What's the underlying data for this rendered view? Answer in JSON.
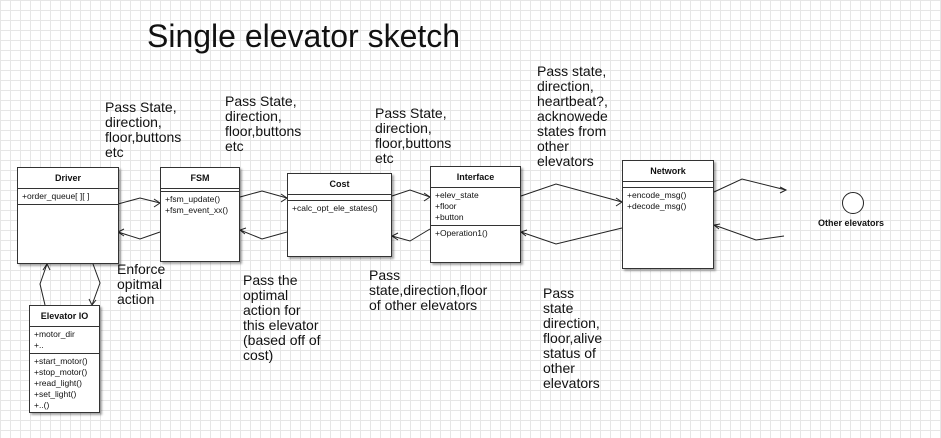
{
  "title": "Single elevator sketch",
  "classes": {
    "driver": {
      "name": "Driver",
      "attributes": [
        "+order_queue[ ][ ]"
      ],
      "operations": []
    },
    "fsm": {
      "name": "FSM",
      "attributes": [],
      "operations": [
        "+fsm_update()",
        "+fsm_event_xx()"
      ]
    },
    "cost": {
      "name": "Cost",
      "attributes": [],
      "operations": [
        "+calc_opt_ele_states()"
      ]
    },
    "interface": {
      "name": "Interface",
      "attributes": [
        "+elev_state",
        "+floor",
        "+button"
      ],
      "operations": [
        "+Operation1()"
      ]
    },
    "network": {
      "name": "Network",
      "attributes": [],
      "operations": [
        "+encode_msg()",
        "+decode_msg()"
      ]
    },
    "elevator_io": {
      "name": "Elevator IO",
      "attributes": [
        "+motor_dir",
        "+.."
      ],
      "operations": [
        "+start_motor()",
        "+stop_motor()",
        "+read_light()",
        "+set_light()",
        "+..()"
      ]
    }
  },
  "actor": {
    "label": "Other elevators"
  },
  "notes": {
    "driver_to_fsm": "Pass State,\ndirection,\nfloor,buttons\netc",
    "fsm_to_cost": "Pass State,\ndirection,\nfloor,buttons\netc",
    "cost_to_interface": "Pass State,\ndirection,\nfloor,buttons\netc",
    "interface_to_network": "Pass state,\ndirection,\nheartbeat?,\nacknowede\nstates from\nother\nelevators",
    "fsm_to_driver": "Enforce\nopitmal\naction",
    "cost_to_fsm": "Pass the\noptimal\naction for\nthis elevator\n(based off of\ncost)",
    "interface_to_cost": "Pass\nstate,direction,floor\nof other elevators",
    "network_to_interface": "Pass\nstate\ndirection,\nfloor,alive\nstatus of\nother\nelevators"
  }
}
